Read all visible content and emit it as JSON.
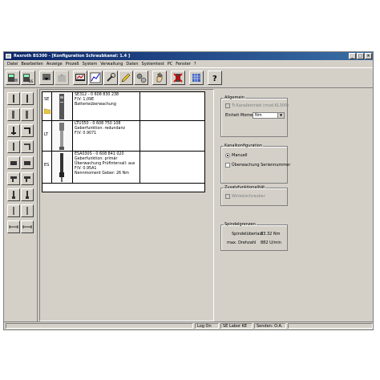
{
  "window": {
    "title": "Rexroth BS300 - [Konfiguration Schraubkanal: 1.4 ]",
    "controls": [
      "_",
      "□",
      "×"
    ]
  },
  "menu": [
    "Datei",
    "Bearbeiten",
    "Anzeige",
    "Prozeß",
    "System",
    "Verwaltung",
    "Daten",
    "Systemtest",
    "PC",
    "Fenster",
    "?"
  ],
  "toolbar": {
    "tool_labels": [
      "BS300",
      "BS300",
      "",
      "DIA"
    ]
  },
  "components": [
    {
      "abbr": "SE",
      "lines": [
        "SE312 - 0 608 830 238",
        "F/V: 1,09E",
        "Batterieüberwachung"
      ]
    },
    {
      "abbr": "LT",
      "lines": [
        "LTU350 - 0 608 750 108",
        "Geberfunktion: redundanz",
        "F/V: 0.9071"
      ]
    },
    {
      "abbr": "ES",
      "lines": [
        "ESA030S - 0 608 841 020",
        "Geberfunktion: primär",
        "Überwachung Prüfintervall: aus",
        "F/V: 0.95A1",
        "Nennmoment Geber: 26 Nm"
      ]
    }
  ],
  "general": {
    "legend": "Allgemein",
    "checkbox_label": "Tr.Kanalbetrieb (mod.KL300)",
    "unit_label": "Einheit Moment",
    "unit_value": "Nm"
  },
  "channel": {
    "legend": "Kanalkonfiguration",
    "radio_label": "Manuell",
    "checkbox_label": "Überwachung Seriennummer"
  },
  "extra": {
    "legend": "Zusatzfunktionalität",
    "checkbox_label": "Winkelschrauber"
  },
  "spindle": {
    "legend": "Spindelgrenzen",
    "overload_label": "Spindelüberlast",
    "overload_value": "33.32 Nm",
    "speed_label": "max. Drehzahl",
    "speed_value": "882 U/min"
  },
  "status": {
    "logon": "Log On",
    "lab": "SE Labor KE",
    "send_label": "Senden",
    "send_value": "O.A."
  }
}
